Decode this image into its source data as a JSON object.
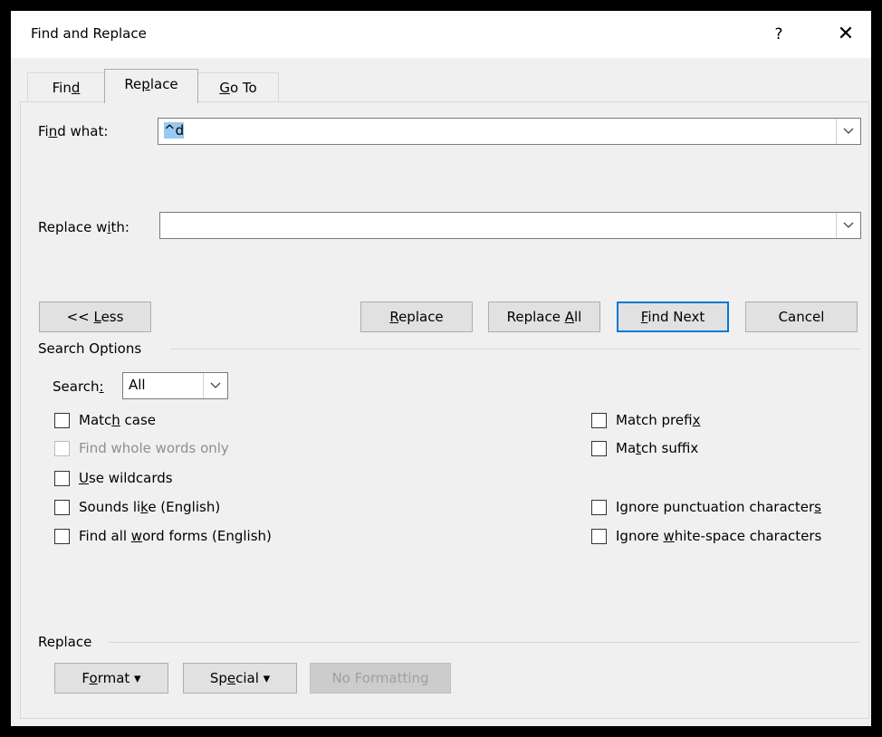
{
  "window": {
    "title": "Find and Replace",
    "help_glyph": "?",
    "close_glyph": "✕"
  },
  "tabs": [
    {
      "label": "Find",
      "accel": "d",
      "pre": "Fin",
      "post": ""
    },
    {
      "label": "Replace",
      "accel": "p",
      "pre": "Re",
      "post": "lace"
    },
    {
      "label": "Go To",
      "accel": "G",
      "pre": "",
      "post": "o To"
    }
  ],
  "find": {
    "label_pre": "Fi",
    "label_accel": "n",
    "label_post": "d what:",
    "value": "^d"
  },
  "replace_field": {
    "label_pre": "Replace w",
    "label_accel": "i",
    "label_post": "th:",
    "value": ""
  },
  "buttons": {
    "less": {
      "pre": "<< ",
      "accel": "L",
      "post": "ess"
    },
    "replace": {
      "pre": "",
      "accel": "R",
      "post": "eplace"
    },
    "replace_all": {
      "pre": "Replace ",
      "accel": "A",
      "post": "ll"
    },
    "find_next": {
      "pre": "",
      "accel": "F",
      "post": "ind Next"
    },
    "cancel": "Cancel"
  },
  "search_options": {
    "heading": "Search Options",
    "search_label_pre": "Search",
    "search_label_accel": ":",
    "search_value": "All",
    "left_options": [
      {
        "pre": "Matc",
        "accel": "h",
        "post": " case",
        "checked": false,
        "disabled": false
      },
      {
        "pre": "Find whole words only",
        "accel": "",
        "post": "",
        "checked": false,
        "disabled": true
      },
      {
        "pre": "",
        "accel": "U",
        "post": "se wildcards",
        "checked": false,
        "disabled": false
      },
      {
        "pre": "Sounds li",
        "accel": "k",
        "post": "e (English)",
        "checked": false,
        "disabled": false
      },
      {
        "pre": "Find all ",
        "accel": "w",
        "post": "ord forms (English)",
        "checked": false,
        "disabled": false
      }
    ],
    "right_options": [
      {
        "pre": "Match prefi",
        "accel": "x",
        "post": "",
        "checked": false,
        "disabled": false
      },
      {
        "pre": "Ma",
        "accel": "t",
        "post": "ch suffix",
        "checked": false,
        "disabled": false
      },
      {
        "pre": "Ignore punctuation character",
        "accel": "s",
        "post": "",
        "checked": false,
        "disabled": false
      },
      {
        "pre": "Ignore ",
        "accel": "w",
        "post": "hite-space characters",
        "checked": false,
        "disabled": false
      }
    ]
  },
  "replace_section": {
    "heading": "Replace",
    "format": {
      "pre": "F",
      "accel": "o",
      "post": "rmat ▾"
    },
    "special": {
      "pre": "Sp",
      "accel": "e",
      "post": "cial ▾"
    },
    "no_formatting": "No Formatting"
  }
}
